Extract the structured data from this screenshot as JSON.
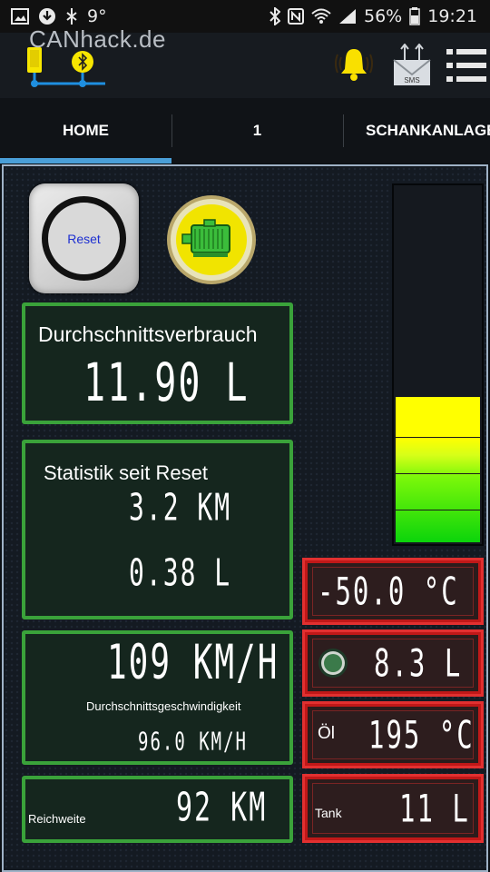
{
  "statusbar": {
    "temp_text": "9°",
    "battery_percent": "56%",
    "time": "19:21"
  },
  "app": {
    "brand": "CANhack.de",
    "icons": [
      "phone-bluetooth-logo-icon",
      "bell-icon",
      "sms-icon",
      "menu-icon"
    ],
    "accent": "#4a9fd8"
  },
  "tabs": [
    {
      "label": "HOME",
      "selected": true
    },
    {
      "label": "1",
      "selected": false
    },
    {
      "label": "SCHANKANLAGE",
      "selected": false
    }
  ],
  "reset": {
    "label": "Reset"
  },
  "consumption": {
    "title": "Durchschnittsverbrauch",
    "value": "11.90 L"
  },
  "stats": {
    "title": "Statistik seit Reset",
    "distance": "3.2 KM",
    "fuel": "0.38 L"
  },
  "speed": {
    "value": "109 KM/H",
    "label": "Durchschnittsgeschwindigkeit",
    "sub_value": "96.0 KM/H"
  },
  "range": {
    "label": "Reichweite",
    "value": "92 KM"
  },
  "temperature": {
    "value": "-50.0 °C"
  },
  "level": {
    "value": "8.3 L"
  },
  "oil": {
    "label": "Öl",
    "value": "195 °C"
  },
  "tank": {
    "label": "Tank",
    "value": "11 L"
  },
  "gauge": {
    "fill_fraction": 0.41,
    "colors": [
      "#ffff00",
      "#0bd40b"
    ]
  },
  "colors": {
    "panel_border": "#3aa23a",
    "alert_border": "#e23030"
  }
}
